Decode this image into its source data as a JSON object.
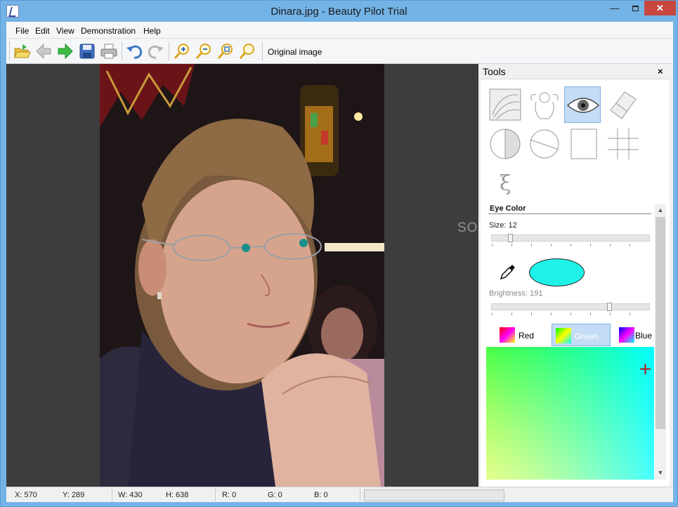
{
  "window": {
    "title": "Dinara.jpg - Beauty Pilot Trial"
  },
  "menu": {
    "items": [
      "File",
      "Edit",
      "View",
      "Demonstration",
      "Help"
    ]
  },
  "toolbar": {
    "buttons": [
      "open-icon",
      "back-arrow-icon",
      "forward-arrow-icon",
      "save-icon",
      "print-icon",
      "undo-icon",
      "redo-icon",
      "zoom-in-icon",
      "zoom-out-icon",
      "zoom-fit-icon",
      "zoom-actual-icon"
    ],
    "original_image_label": "Original image"
  },
  "tools": {
    "title": "Tools",
    "close_glyph": "×",
    "icons": [
      "hair-texture-icon",
      "angel-icon",
      "eye-icon",
      "eraser-icon",
      "half-circle-icon",
      "slash-circle-icon",
      "frame-icon",
      "grid-icon",
      "xi-symbol-icon"
    ],
    "selected": "eye-icon",
    "eye_color": {
      "section_label": "Eye Color",
      "size_label": "Size: 12",
      "size_value": 12,
      "brightness_label": "Brightness: 191",
      "brightness_value": 191,
      "selected_color": "#1ef2e8",
      "channels": [
        "Red",
        "Green",
        "Blue"
      ],
      "selected_channel": "Green"
    }
  },
  "watermark": "SOFTPEDIA",
  "status": {
    "x": "X: 570",
    "y": "Y: 289",
    "w": "W: 430",
    "h": "H: 638",
    "r": "R: 0",
    "g": "G: 0",
    "b": "B: 0"
  }
}
